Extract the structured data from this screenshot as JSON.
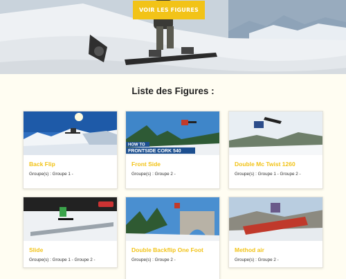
{
  "hero": {
    "cta_label": "VOIR LES FIGURES"
  },
  "section": {
    "title": "Liste des Figures :"
  },
  "cards": [
    {
      "title": "Back Flip",
      "groups": "Groupe(s) : Groupe 1 -",
      "image_caption": ""
    },
    {
      "title": "Front Side",
      "groups": "Groupe(s) : Groupe 2 -",
      "image_caption_top": "HOW TO",
      "image_caption": "FRONTSIDE CORK 540"
    },
    {
      "title": "Double Mc Twist 1260",
      "groups": "Groupe(s) : Groupe 1 - Groupe 2 -"
    },
    {
      "title": "Slide",
      "groups": "Groupe(s) : Groupe 1 - Groupe 2 -"
    },
    {
      "title": "Double Backflip One Foot",
      "groups": "Groupe(s) : Groupe 2 -"
    },
    {
      "title": "Method air",
      "groups": "Groupe(s) : Groupe 2 -"
    }
  ],
  "colors": {
    "accent": "#f2c318",
    "background": "#fffdf2"
  }
}
